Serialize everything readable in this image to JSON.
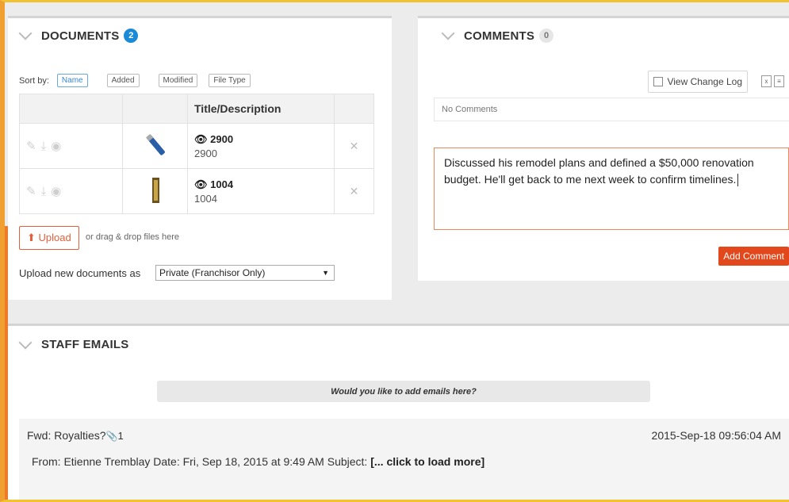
{
  "documents": {
    "title": "DOCUMENTS",
    "count": "2",
    "sort_label": "Sort by:",
    "sort_buttons": [
      "Name",
      "Added",
      "Modified",
      "File Type"
    ],
    "table_header": "Title/Description",
    "rows": [
      {
        "title": "2900",
        "description": "2900"
      },
      {
        "title": "1004",
        "description": "1004"
      }
    ],
    "upload_label": "Upload",
    "drop_hint": "or drag & drop files here",
    "upload_as_label": "Upload new documents as",
    "upload_as_value": "Private (Franchisor Only)"
  },
  "comments": {
    "title": "COMMENTS",
    "count": "0",
    "view_change_log": "View Change Log",
    "no_comments": "No Comments",
    "draft": "Discussed his remodel plans and defined a $50,000 renovation budget. He'll get back to me next week to confirm timelines.",
    "add_button": "Add Comment"
  },
  "staff_emails": {
    "title": "STAFF EMAILS",
    "prompt": "Would you like to add emails here?",
    "email": {
      "subject": "Fwd: Royalties?",
      "attachments": "1",
      "date": "2015-Sep-18 09:56:04 AM",
      "preview": "From: Etienne Tremblay Date: Fri, Sep 18, 2015 at 9:49 AM Subject:",
      "load_more": "[... click to load more]"
    }
  },
  "colors": {
    "accent_orange": "#e2481b",
    "badge_blue": "#1a8ad6",
    "frame_yellow": "#f2c230"
  }
}
